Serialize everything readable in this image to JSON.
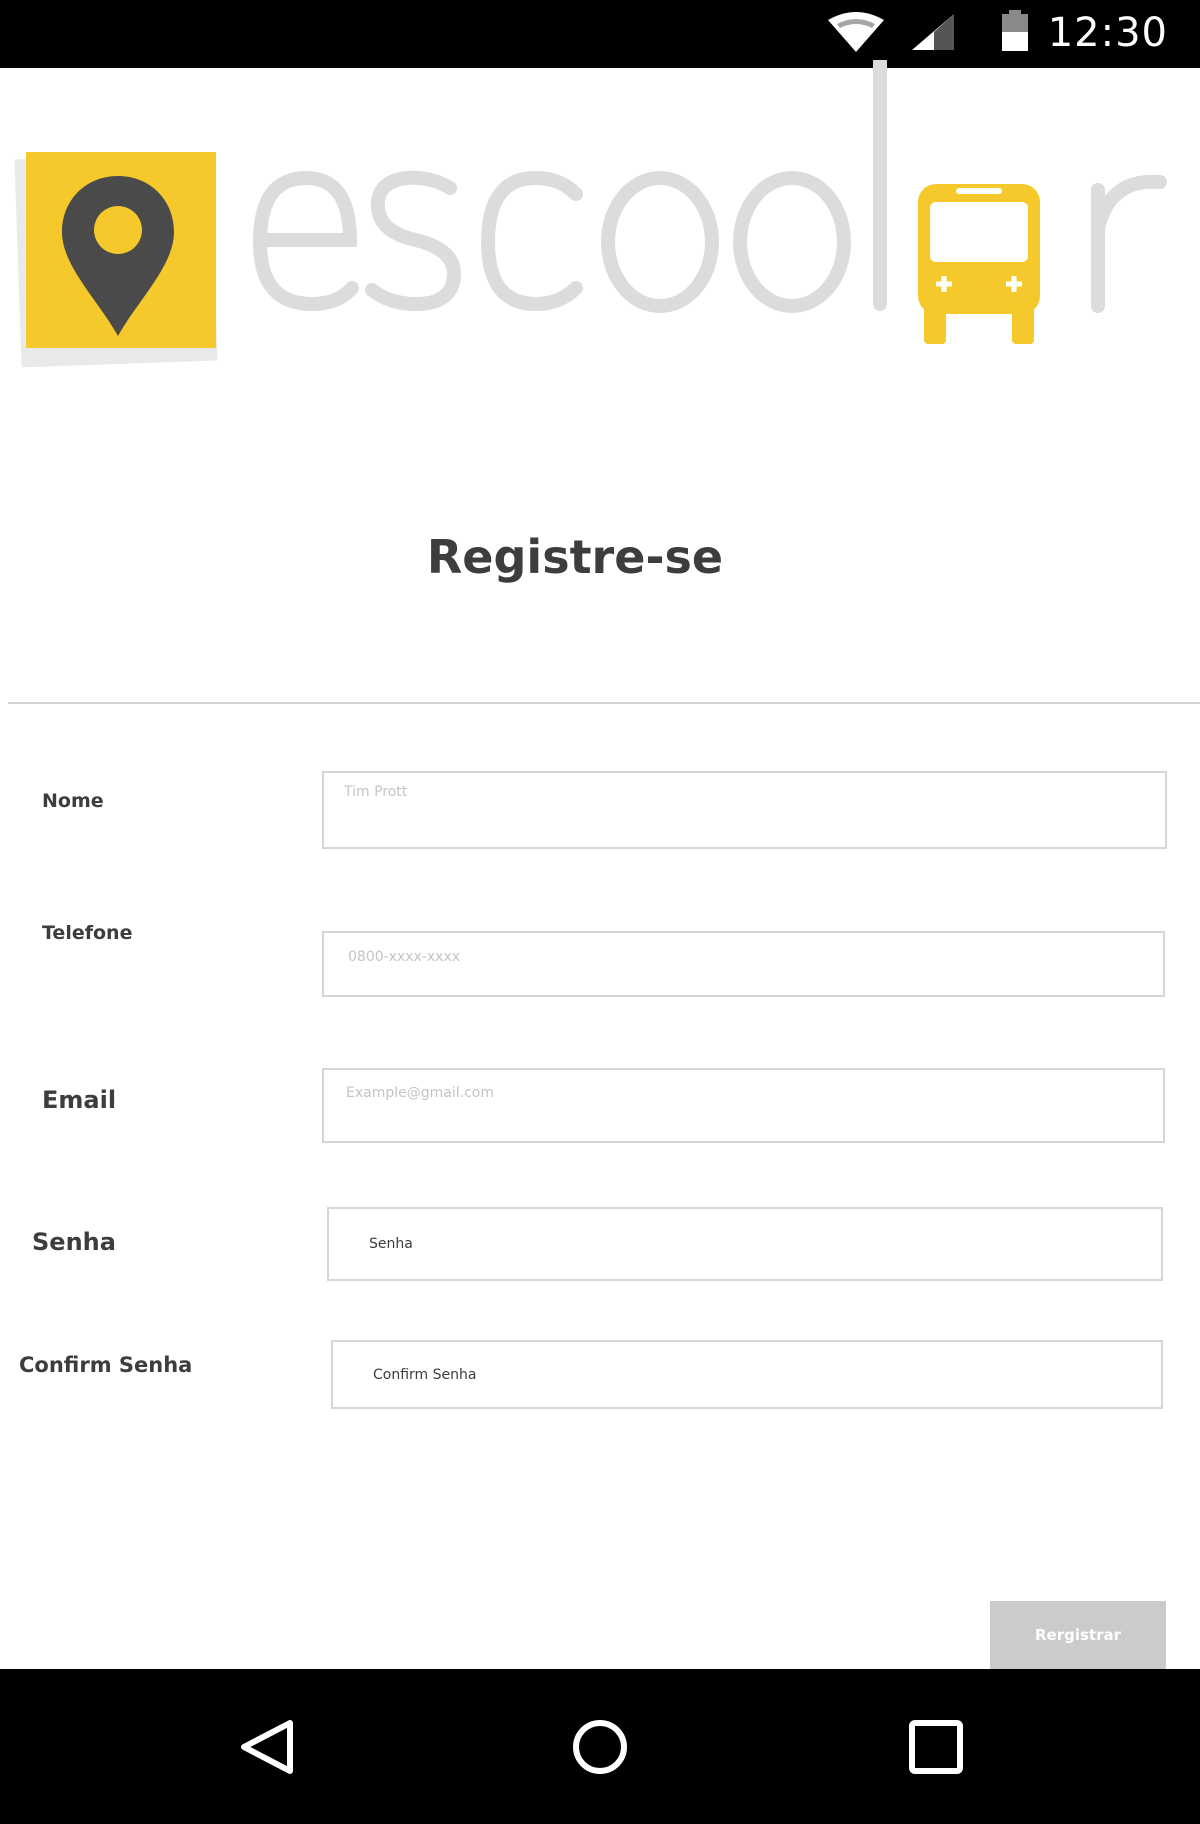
{
  "status_bar": {
    "time": "12:30",
    "icons": [
      "wifi-icon",
      "cell-signal-icon",
      "battery-icon"
    ]
  },
  "logo": {
    "wordmark": "escoolar",
    "icons": [
      "location-pin-icon",
      "school-bus-icon"
    ],
    "colors": {
      "accent": "#f5c92b",
      "pin": "#4a4a4a",
      "wordmark": "#dcdcdc"
    }
  },
  "page": {
    "title": "Registre-se"
  },
  "form": {
    "nome": {
      "label": "Nome",
      "placeholder": "Tim Prott"
    },
    "telefone": {
      "label": "Telefone",
      "placeholder": "0800-xxxx-xxxx"
    },
    "email": {
      "label": "Email",
      "placeholder": "Example@gmail.com"
    },
    "senha": {
      "label": "Senha",
      "value": "Senha"
    },
    "confirm_senha": {
      "label": "Confirm Senha",
      "value": "Confirm Senha"
    },
    "submit_label": "Rergistrar"
  },
  "nav_bar": {
    "icons": [
      "back-icon",
      "home-icon",
      "recent-apps-icon"
    ]
  }
}
